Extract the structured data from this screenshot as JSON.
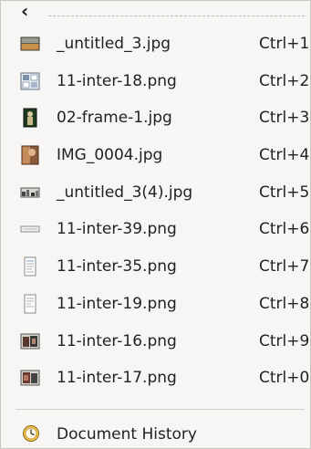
{
  "menu": {
    "back_glyph": "‹",
    "items": [
      {
        "label": "_untitled_3.jpg",
        "accel": "Ctrl+1",
        "icon": "landscape-photo-icon"
      },
      {
        "label": "11-inter-18.png",
        "accel": "Ctrl+2",
        "icon": "grid-image-icon"
      },
      {
        "label": "02-frame-1.jpg",
        "accel": "Ctrl+3",
        "icon": "figure-photo-icon"
      },
      {
        "label": "IMG_0004.jpg",
        "accel": "Ctrl+4",
        "icon": "portrait-photo-icon"
      },
      {
        "label": "_untitled_3(4).jpg",
        "accel": "Ctrl+5",
        "icon": "wide-photo-icon"
      },
      {
        "label": "11-inter-39.png",
        "accel": "Ctrl+6",
        "icon": "strip-image-icon"
      },
      {
        "label": "11-inter-35.png",
        "accel": "Ctrl+7",
        "icon": "document-image-icon"
      },
      {
        "label": "11-inter-19.png",
        "accel": "Ctrl+8",
        "icon": "document-image-icon"
      },
      {
        "label": "11-inter-16.png",
        "accel": "Ctrl+9",
        "icon": "screenshot-image-icon"
      },
      {
        "label": "11-inter-17.png",
        "accel": "Ctrl+0",
        "icon": "screenshot-image-icon"
      }
    ],
    "history_label": "Document History",
    "history_icon": "clock-icon"
  }
}
